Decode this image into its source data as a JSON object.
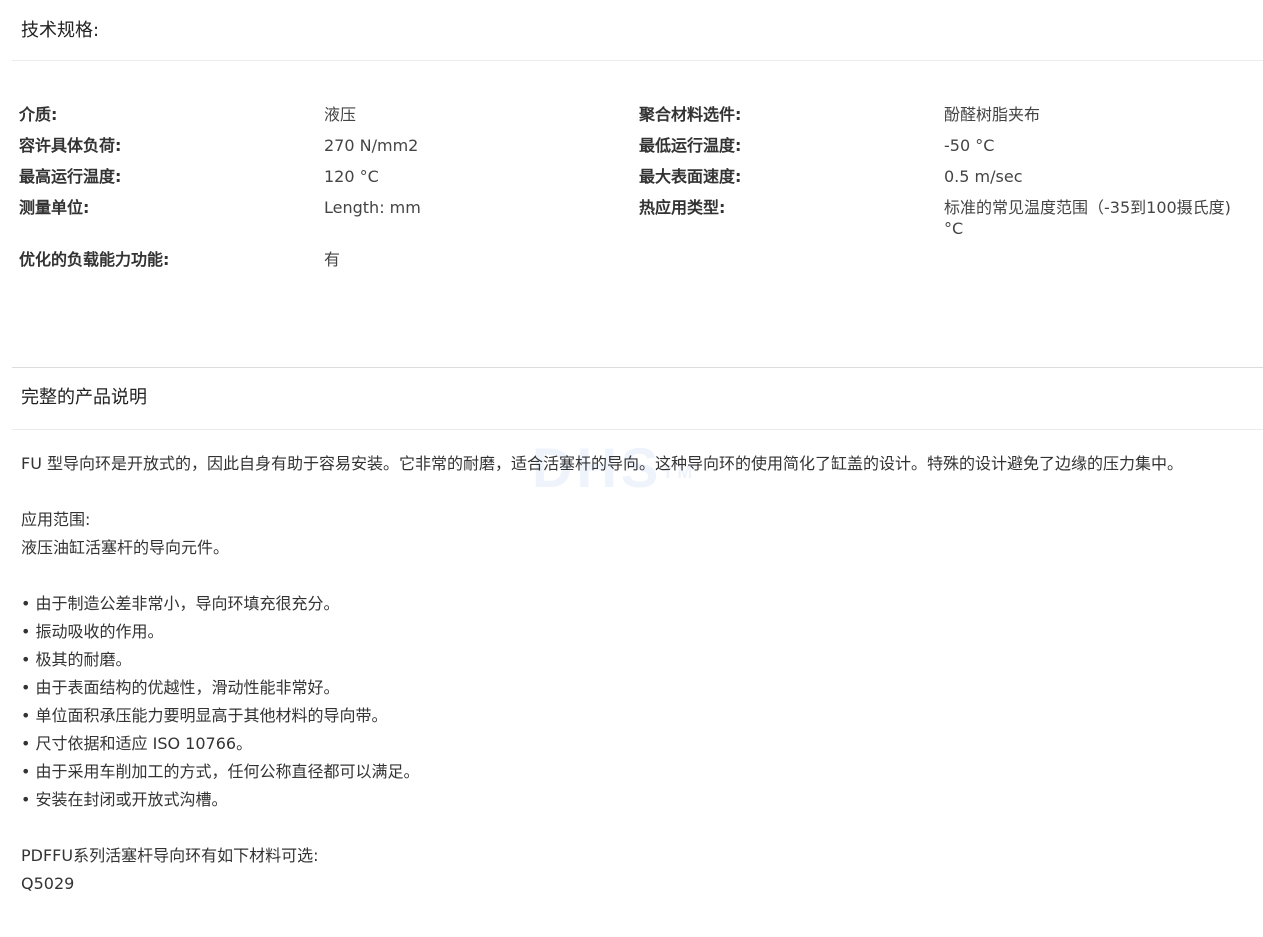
{
  "spec_section": {
    "title": "技术规格:",
    "rows": [
      {
        "l1": "介质:",
        "v1": "液压",
        "l2": "聚合材料选件:",
        "v2": "酚醛树脂夹布"
      },
      {
        "l1": "容许具体负荷:",
        "v1": "270 N/mm2",
        "l2": "最低运行温度:",
        "v2": "-50 °C"
      },
      {
        "l1": "最高运行温度:",
        "v1": "120 °C",
        "l2": "最大表面速度:",
        "v2": "0.5 m/sec"
      },
      {
        "l1": "测量单位:",
        "v1": "Length: mm",
        "l2": "热应用类型:",
        "v2": "标准的常见温度范围（-35到100摄氏度) °C"
      },
      {
        "l1": "优化的负载能力功能:",
        "v1": "有",
        "l2": "",
        "v2": ""
      }
    ]
  },
  "desc_section": {
    "title": "完整的产品说明",
    "intro": "FU 型导向环是开放式的，因此自身有助于容易安装。它非常的耐磨，适合活塞杆的导向。这种导向环的使用简化了缸盖的设计。特殊的设计避免了边缘的压力集中。",
    "application_label": "应用范围:",
    "application_text": "液压油缸活塞杆的导向元件。",
    "bullets": [
      "• 由于制造公差非常小，导向环填充很充分。",
      "• 振动吸收的作用。",
      "• 极其的耐磨。",
      "• 由于表面结构的优越性，滑动性能非常好。",
      "• 单位面积承压能力要明显高于其他材料的导向带。",
      "• 尺寸依据和适应 ISO 10766。",
      "• 由于采用车削加工的方式，任何公称直径都可以满足。",
      "• 安装在封闭或开放式沟槽。"
    ],
    "materials_label": "PDFFU系列活塞杆导向环有如下材料可选:",
    "materials": [
      "Q5029"
    ]
  },
  "watermark": {
    "text": "DHS",
    "tm": "TM"
  }
}
